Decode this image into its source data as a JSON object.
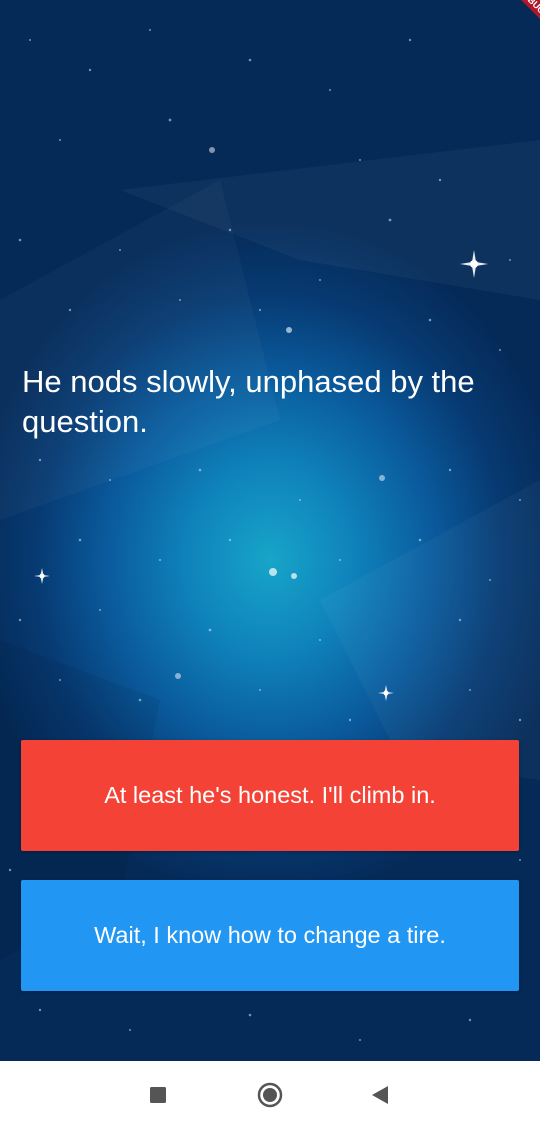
{
  "debug_banner": "DEBUG",
  "story": {
    "text": "He nods slowly, unphased by the question."
  },
  "choices": [
    {
      "label": "At least he's honest. I'll climb in.",
      "color": "#f44336"
    },
    {
      "label": "Wait, I know how to change a tire.",
      "color": "#2196f3"
    }
  ],
  "nav_bar": {
    "icons": [
      "recents-square-icon",
      "home-circle-icon",
      "back-triangle-icon"
    ],
    "icon_color": "#555555"
  }
}
